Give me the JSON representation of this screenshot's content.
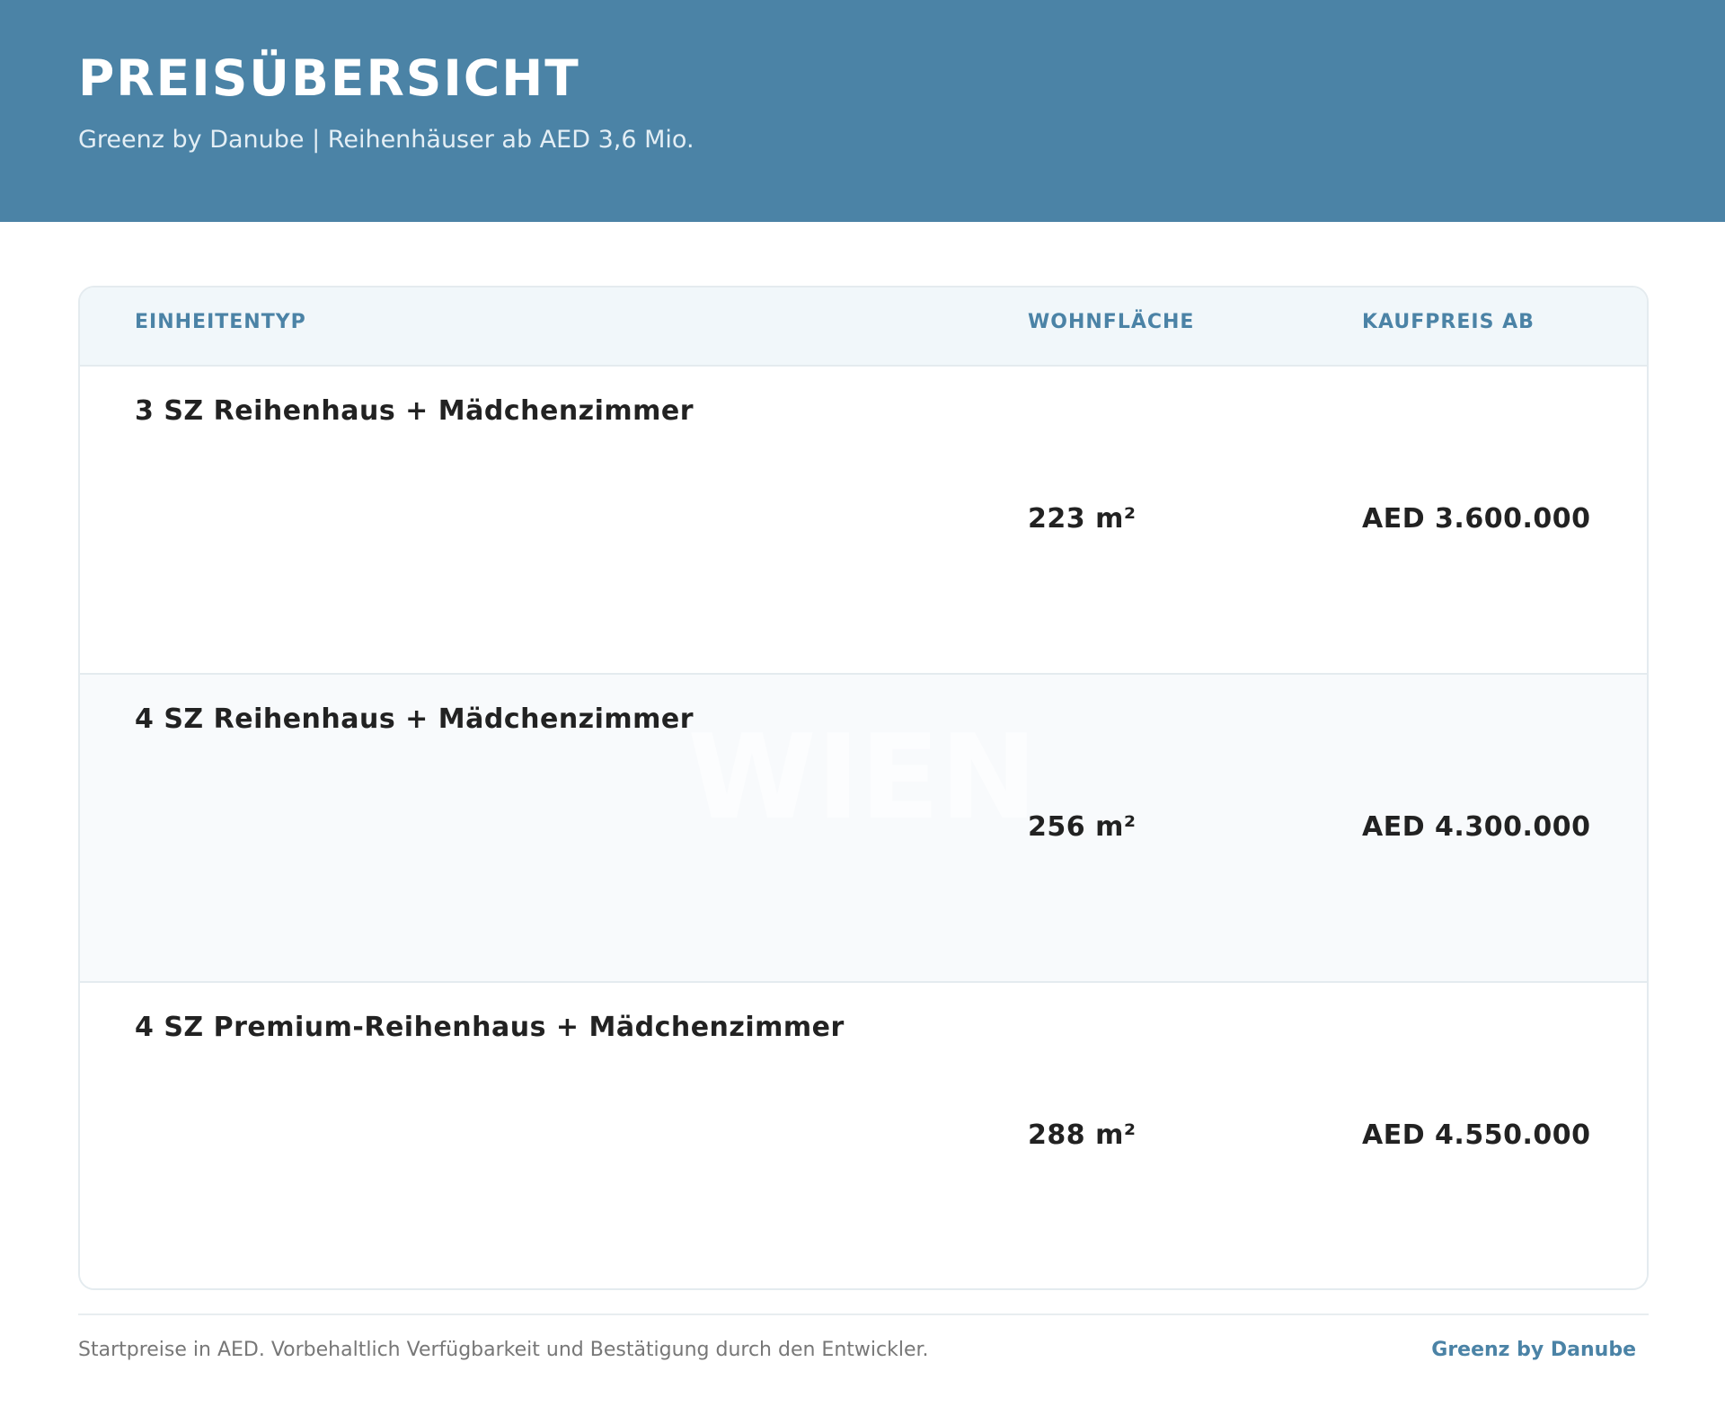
{
  "header": {
    "title": "PREISÜBERSICHT",
    "subtitle": "Greenz by Danube | Reihenhäuser ab AED 3,6 Mio."
  },
  "table": {
    "columns": [
      "EINHEITENTYP",
      "WOHNFLÄCHE",
      "KAUFPREIS AB"
    ],
    "rows": [
      {
        "type": "3 SZ Reihenhaus + Mädchenzimmer",
        "area": "223 m²",
        "price": "AED 3.600.000"
      },
      {
        "type": "4 SZ Reihenhaus + Mädchenzimmer",
        "area": "256 m²",
        "price": "AED 4.300.000"
      },
      {
        "type": "4 SZ Premium-Reihenhaus + Mädchenzimmer",
        "area": "288 m²",
        "price": "AED 4.550.000"
      }
    ]
  },
  "watermark": "WIEN",
  "footer": {
    "note": "Startpreise in AED. Vorbehaltlich Verfügbarkeit und Bestätigung durch den Entwickler.",
    "brand": "Greenz by Danube"
  },
  "colors": {
    "header_bg": "#4b83a6",
    "accent": "#4b83a6",
    "table_head_bg": "#f1f7fa",
    "row_alt_bg": "#f8fafc"
  }
}
